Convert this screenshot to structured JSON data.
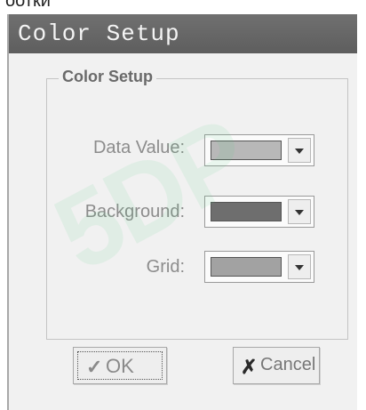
{
  "window": {
    "title": "Color Setup"
  },
  "group": {
    "title": "Color Setup"
  },
  "rows": [
    {
      "label": "Data Value:",
      "color": "#b8b8b8"
    },
    {
      "label": "Background:",
      "color": "#6e6e6e"
    },
    {
      "label": "Grid:",
      "color": "#a2a2a2"
    }
  ],
  "buttons": {
    "ok_label": "OK",
    "ok_icon": "check-icon",
    "cancel_label": "Cancel",
    "cancel_icon": "x-icon"
  }
}
